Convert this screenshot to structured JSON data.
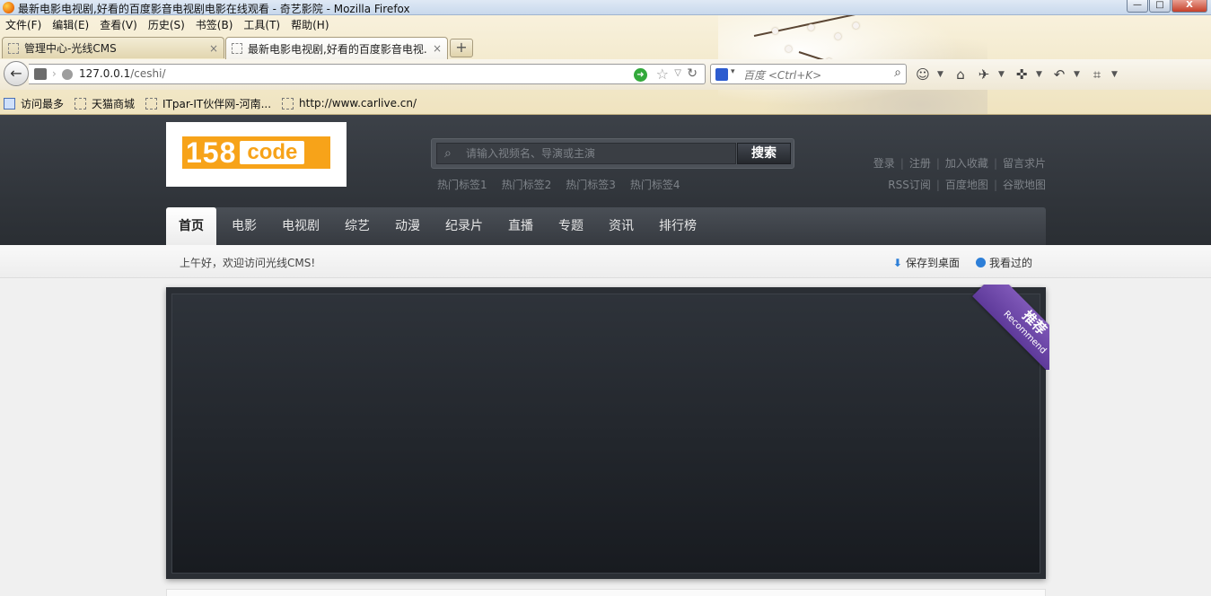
{
  "window": {
    "title": "最新电影电视剧,好看的百度影音电视剧电影在线观看 - 奇艺影院 - Mozilla Firefox",
    "buttons": {
      "minimize": "—",
      "maximize": "□",
      "close": "X"
    }
  },
  "menu": [
    "文件(F)",
    "编辑(E)",
    "查看(V)",
    "历史(S)",
    "书签(B)",
    "工具(T)",
    "帮助(H)"
  ],
  "tabs": [
    {
      "label": "管理中心-光线CMS",
      "close": "×"
    },
    {
      "label": "最新电影电视剧,好看的百度影音电视...",
      "close": "×"
    }
  ],
  "new_tab": "+",
  "navbar": {
    "back": "←",
    "url_host": "127.0.0.1",
    "url_path": "/ceshi/",
    "search_placeholder": "百度 <Ctrl+K>"
  },
  "bookmarks": [
    "访问最多",
    "天猫商城",
    "ITpar-IT伙伴网-河南...",
    "http://www.carlive.cn/"
  ],
  "site": {
    "logo": {
      "num": "158",
      "word": "code"
    },
    "search": {
      "placeholder": "请输入视频名、导演或主演",
      "button": "搜索"
    },
    "hot_tags": [
      "热门标签1",
      "热门标签2",
      "热门标签3",
      "热门标签4"
    ],
    "top_links_row1": [
      "登录",
      "注册",
      "加入收藏",
      "留言求片"
    ],
    "top_links_row2": [
      "RSS订阅",
      "百度地图",
      "谷歌地图"
    ],
    "nav": [
      "首页",
      "电影",
      "电视剧",
      "综艺",
      "动漫",
      "纪录片",
      "直播",
      "专题",
      "资讯",
      "排行榜"
    ],
    "welcome": "上午好，欢迎访问光线CMS!",
    "save_desktop": "保存到桌面",
    "history": "我看过的",
    "ribbon": {
      "cn": "推荐",
      "en": "Recommend"
    }
  },
  "colors": {
    "accent": "#f7a319",
    "header_dark": "#2a2e33",
    "ribbon": "#6b45a8"
  }
}
